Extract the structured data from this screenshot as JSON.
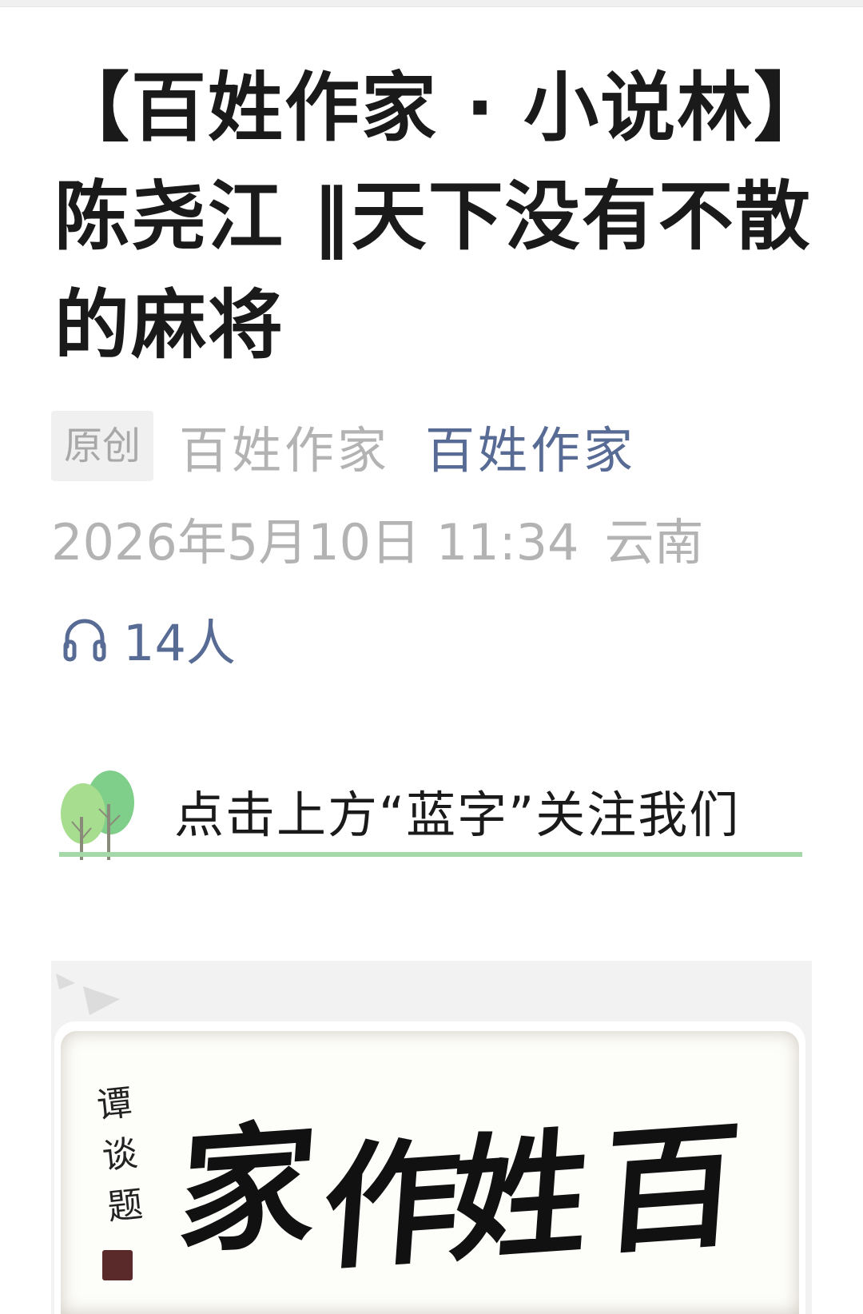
{
  "article": {
    "title": "【百姓作家 · 小说林】陈尧江 ‖天下没有不散的麻将",
    "original_badge": "原创",
    "author": "百姓作家",
    "account": "百姓作家",
    "date": "2026年5月10日 11:34",
    "location": "云南",
    "listen_count": "14人"
  },
  "follow_banner": {
    "text": "点击上方“蓝字”关注我们"
  },
  "calligraphy": {
    "chars": [
      "家",
      "作",
      "姓",
      "百"
    ],
    "signature": "谭谈题"
  },
  "icons": {
    "headphones": "headphones-icon",
    "trees": "tree-illustration",
    "arrows": "double-arrow-decor"
  },
  "colors": {
    "title": "#1a1a1a",
    "meta": "#b3b3b3",
    "link": "#576b95",
    "accent_green": "#a5d8a9"
  }
}
